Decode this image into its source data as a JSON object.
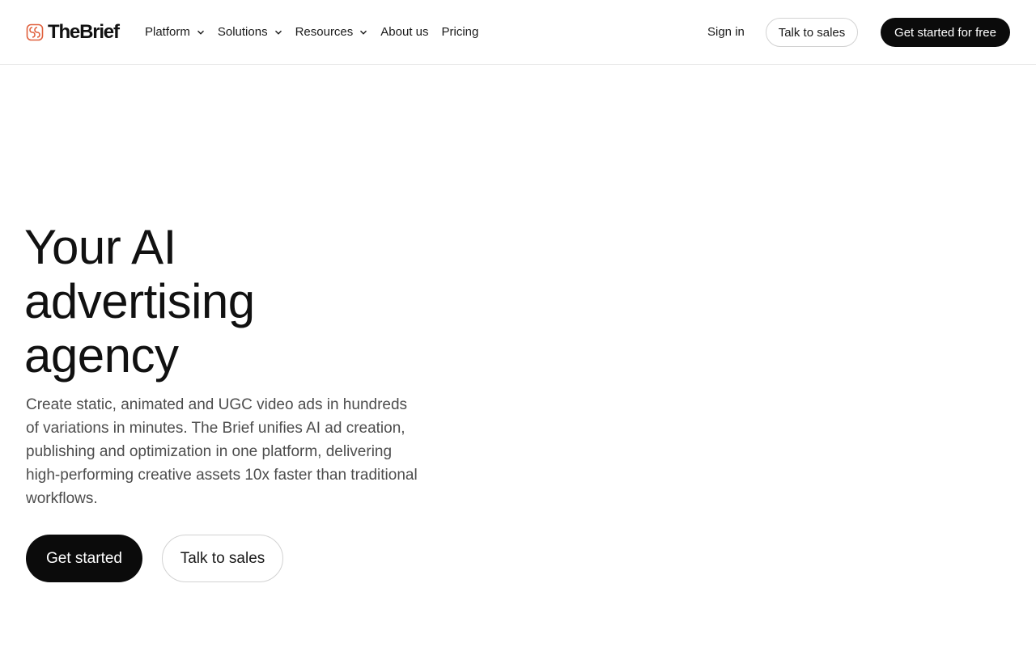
{
  "brand": {
    "name": "TheBrief",
    "logo_icon": "brand-logo-icon",
    "logo_color": "#e0603d"
  },
  "nav": {
    "items": [
      {
        "label": "Platform",
        "has_dropdown": true,
        "icon": "chevron-down-icon"
      },
      {
        "label": "Solutions",
        "has_dropdown": true,
        "icon": "chevron-down-icon"
      },
      {
        "label": "Resources",
        "has_dropdown": true,
        "icon": "chevron-down-icon"
      },
      {
        "label": "About us",
        "has_dropdown": false
      },
      {
        "label": "Pricing",
        "has_dropdown": false
      }
    ],
    "sign_in_label": "Sign in",
    "talk_to_sales_label": "Talk to sales",
    "get_started_free_label": "Get started for free"
  },
  "hero": {
    "title_line_1": "Your AI",
    "title_line_2": "advertising",
    "title_line_3": "agency",
    "subtitle": "Create static, animated and UGC video ads in hundreds of variations in minutes. The Brief unifies AI ad creation, publishing and optimization in one platform, delivering high-performing creative assets 10x faster than traditional workflows.",
    "primary_cta_label": "Get started",
    "secondary_cta_label": "Talk to sales"
  },
  "colors": {
    "primary_button": "#0b0b0b",
    "text": "#111111",
    "muted_text": "#4d4d4d",
    "border": "#d2d2d2"
  }
}
